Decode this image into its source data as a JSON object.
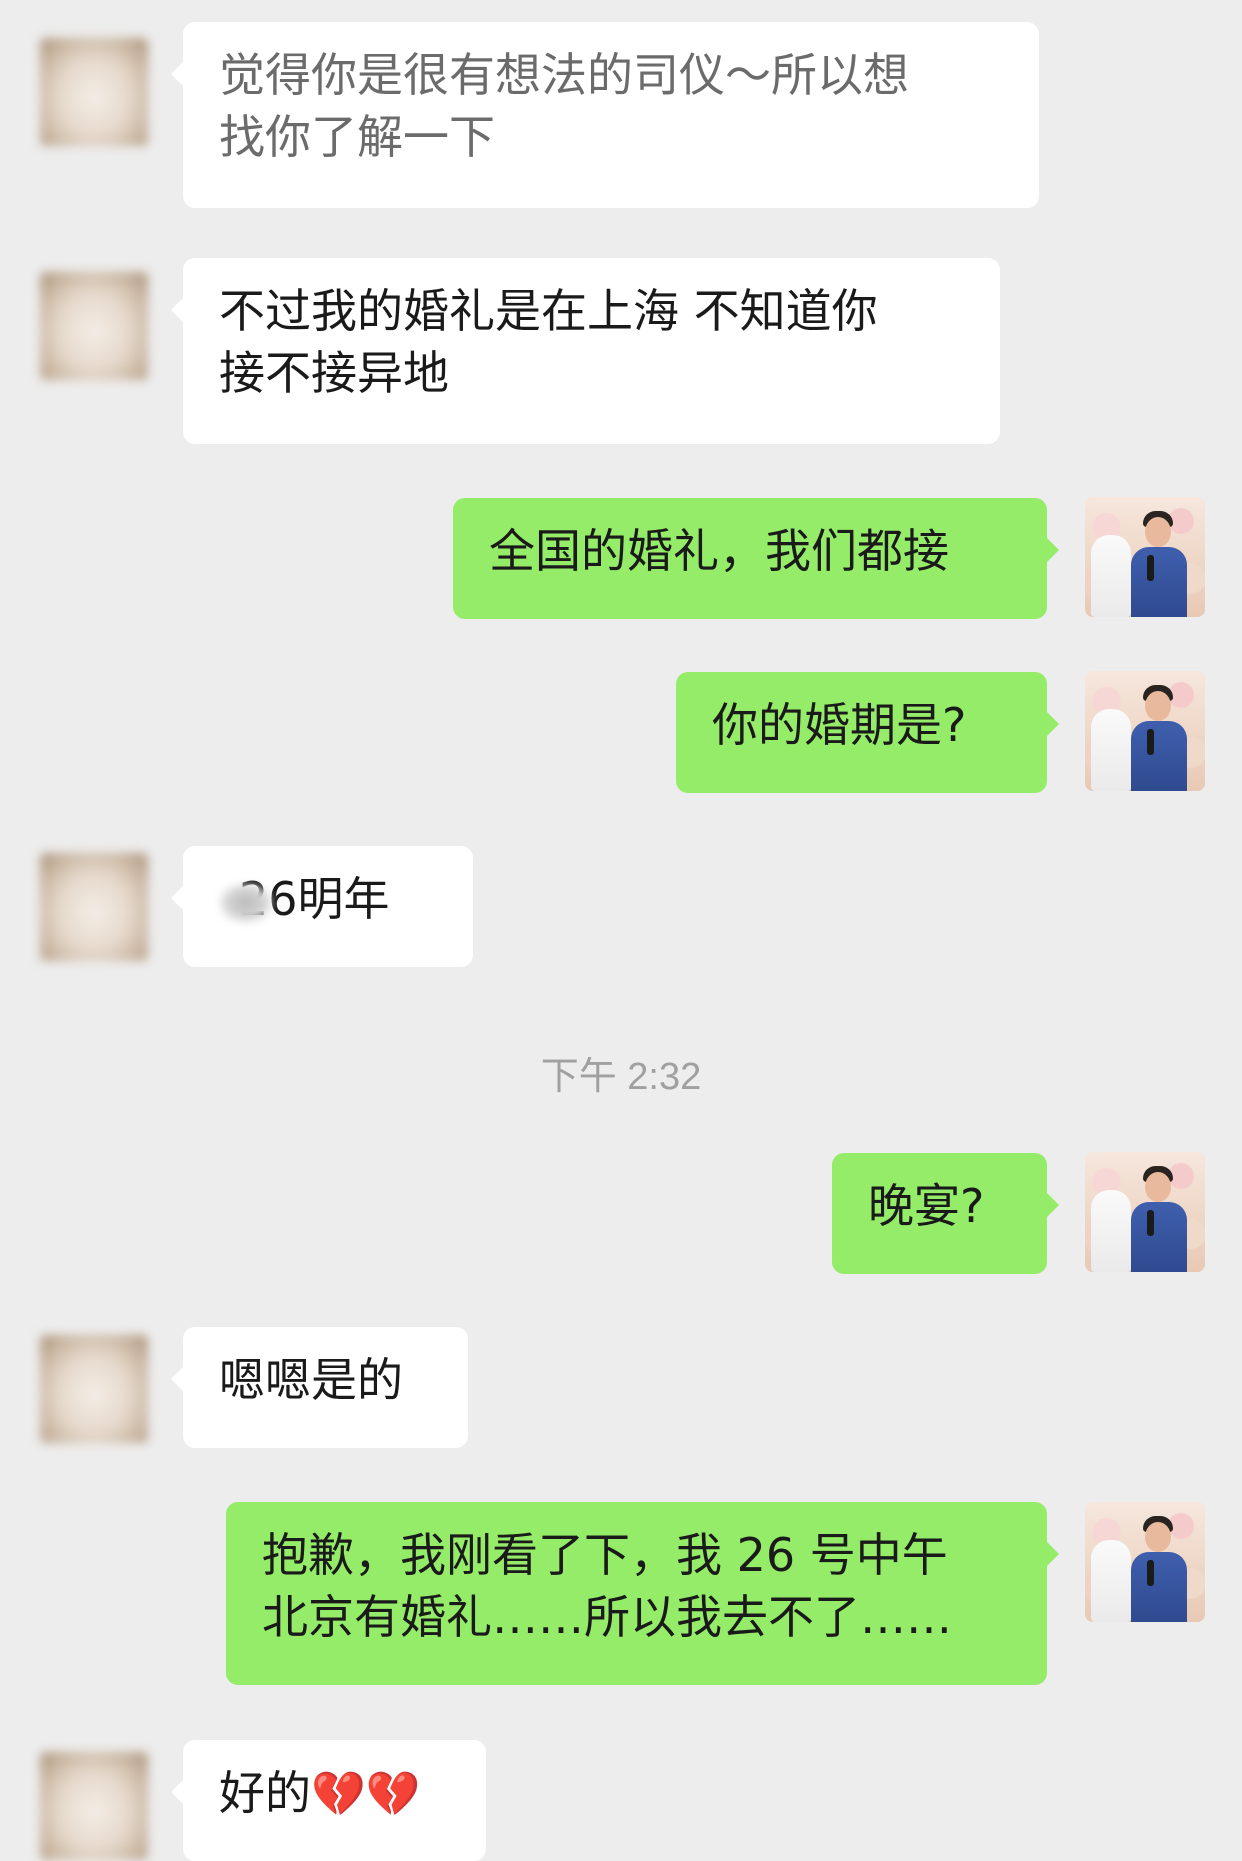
{
  "timestamp": "下午 2:32",
  "messages": [
    {
      "side": "them",
      "lines": [
        "觉得你是很有想法的司仪～所以想",
        "找你了解一下"
      ]
    },
    {
      "side": "them",
      "lines": [
        "不过我的婚礼是在上海 不知道你",
        "接不接异地"
      ]
    },
    {
      "side": "me",
      "text": "全国的婚礼，我们都接"
    },
    {
      "side": "me",
      "text": "你的婚期是?"
    },
    {
      "side": "them",
      "text": "26明年"
    },
    {
      "side": "me",
      "text": "晚宴?"
    },
    {
      "side": "them",
      "text": "嗯嗯是的"
    },
    {
      "side": "me",
      "lines": [
        "抱歉，我刚看了下，我 26 号中午",
        "北京有婚礼……所以我去不了……"
      ]
    },
    {
      "side": "them",
      "text": "好的",
      "emoji": "💔💔"
    }
  ]
}
